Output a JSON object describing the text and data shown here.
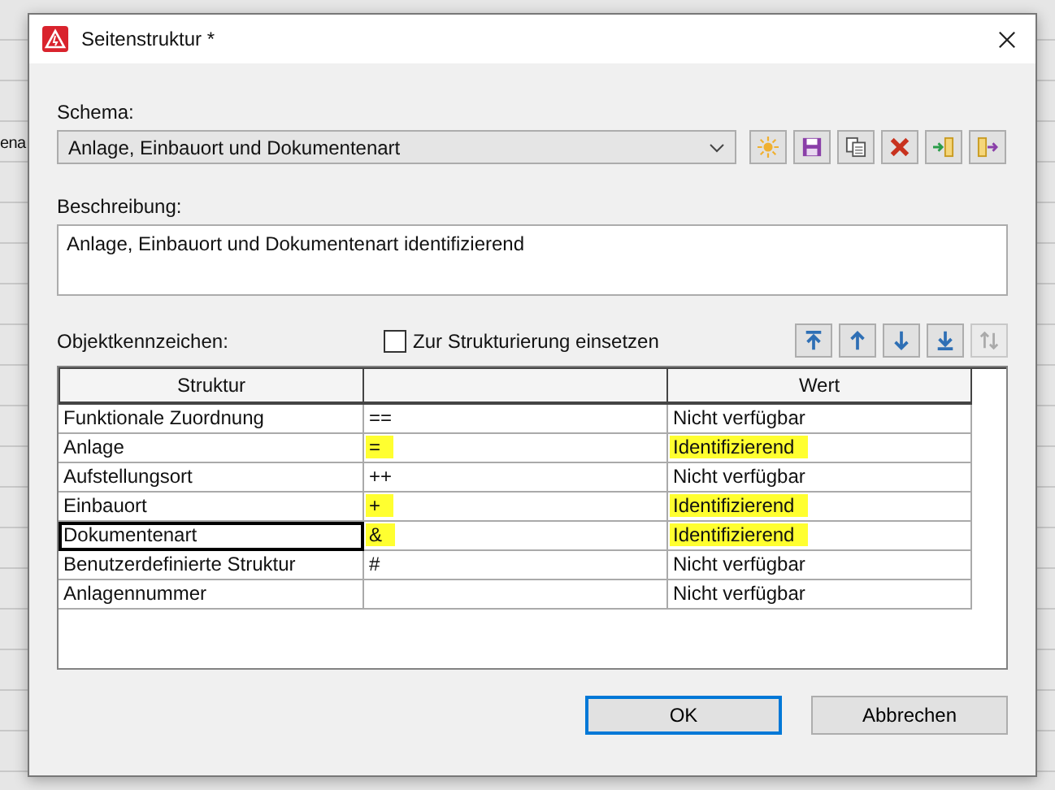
{
  "background_fragment": "ena",
  "window": {
    "title": "Seitenstruktur *"
  },
  "schema": {
    "label": "Schema:",
    "value": "Anlage, Einbauort und Dokumentenart"
  },
  "schema_tools": [
    {
      "kind": "new",
      "disabled": false
    },
    {
      "kind": "save",
      "disabled": false
    },
    {
      "kind": "copy",
      "disabled": false
    },
    {
      "kind": "delete",
      "disabled": false
    },
    {
      "kind": "import",
      "disabled": false
    },
    {
      "kind": "export",
      "disabled": false
    }
  ],
  "description": {
    "label": "Beschreibung:",
    "value": "Anlage, Einbauort und Dokumentenart identifizierend"
  },
  "object_ids": {
    "label": "Objektkennzeichen:",
    "checkbox": {
      "label": "Zur Strukturierung einsetzen",
      "checked": false
    }
  },
  "move_tools": [
    {
      "kind": "top",
      "disabled": false
    },
    {
      "kind": "up",
      "disabled": false
    },
    {
      "kind": "down",
      "disabled": false
    },
    {
      "kind": "bottom",
      "disabled": false
    },
    {
      "kind": "swap",
      "disabled": true
    }
  ],
  "table": {
    "columns": [
      "Struktur",
      "",
      "Wert"
    ],
    "rows": [
      {
        "struktur": "Funktionale Zuordnung",
        "symbol": "==",
        "wert": "Nicht verfügbar",
        "highlighted": false,
        "selected": false
      },
      {
        "struktur": "Anlage",
        "symbol": "=",
        "wert": "Identifizierend",
        "highlighted": true,
        "selected": false
      },
      {
        "struktur": "Aufstellungsort",
        "symbol": "++",
        "wert": "Nicht verfügbar",
        "highlighted": false,
        "selected": false
      },
      {
        "struktur": "Einbauort",
        "symbol": "+",
        "wert": "Identifizierend",
        "highlighted": true,
        "selected": false
      },
      {
        "struktur": "Dokumentenart",
        "symbol": "&",
        "wert": "Identifizierend",
        "highlighted": true,
        "selected": true
      },
      {
        "struktur": "Benutzerdefinierte Struktur",
        "symbol": "#",
        "wert": "Nicht verfügbar",
        "highlighted": false,
        "selected": false
      },
      {
        "struktur": "Anlagennummer",
        "wert": "Nicht verfügbar",
        "highlighted": false,
        "selected": false
      }
    ]
  },
  "buttons": [
    {
      "label": "OK",
      "default": true
    },
    {
      "label": "Abbrechen",
      "default": false
    }
  ]
}
